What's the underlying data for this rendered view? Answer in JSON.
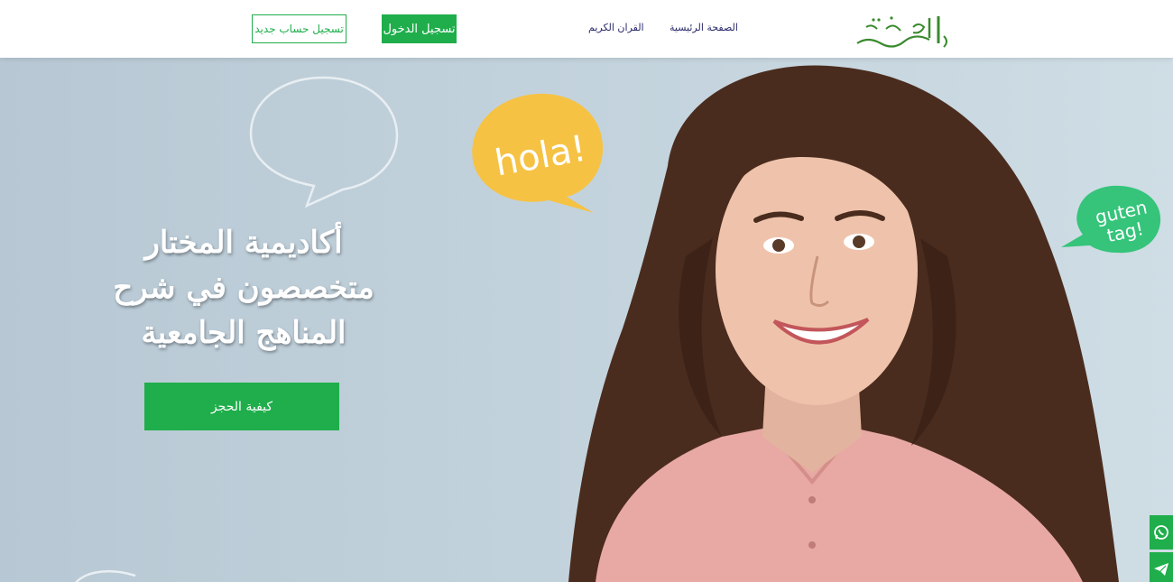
{
  "header": {
    "register_label": "تسجيل حساب جديد",
    "login_label": "تسجيل الدخول",
    "nav": {
      "quran": "القران الكريم",
      "home": "الصفحة الرئيسية"
    },
    "logo_text": "المختار"
  },
  "hero": {
    "title_line1": "أكاديمية المختار",
    "title_line2": "متخصصون في شرح",
    "title_line3": "المناهج الجامعية",
    "cta_label": "كيفية الحجز",
    "bubble_hola": "hola!",
    "bubble_guten_1": "guten",
    "bubble_guten_2": "tag!"
  },
  "social": {
    "whatsapp_icon": "whatsapp-icon",
    "telegram_icon": "telegram-icon"
  },
  "colors": {
    "accent": "#1fae4b",
    "hola_bubble": "#f6c244",
    "guten_bubble": "#35c47a",
    "nav_text": "#2b2b6b"
  }
}
